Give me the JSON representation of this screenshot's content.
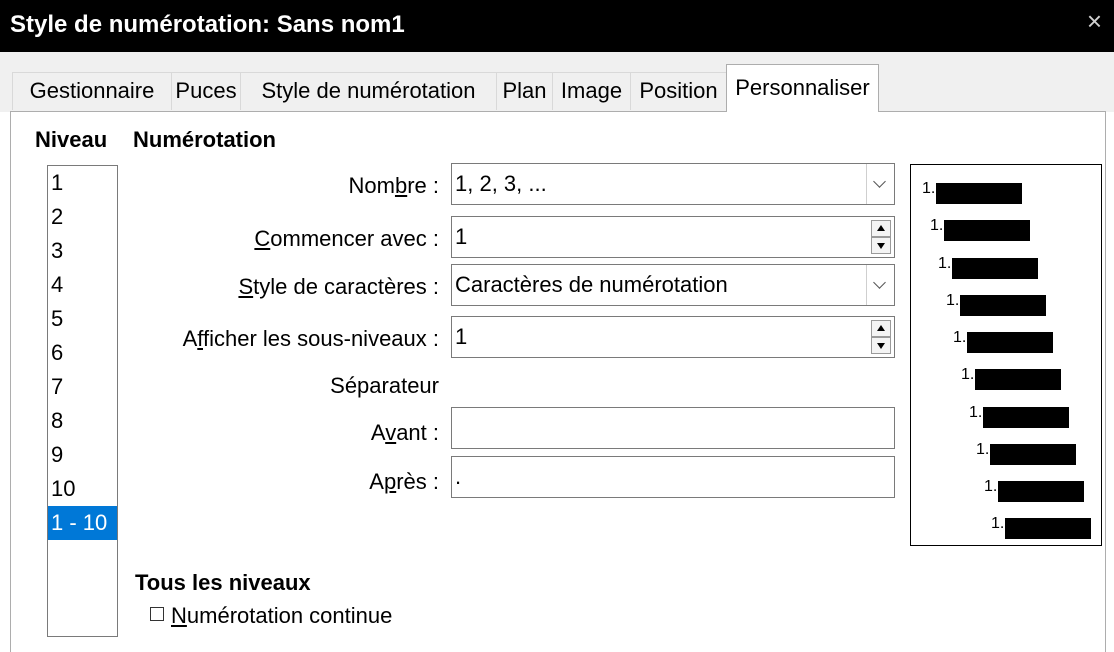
{
  "dialog": {
    "title": "Style de numérotation: Sans nom1",
    "close_glyph": "×"
  },
  "tabs": [
    {
      "label": "Gestionnaire"
    },
    {
      "label": "Puces"
    },
    {
      "label": "Style de numérotation"
    },
    {
      "label": "Plan"
    },
    {
      "label": "Image"
    },
    {
      "label": "Position"
    },
    {
      "label": "Personnaliser",
      "active": true
    }
  ],
  "level_section": {
    "heading": "Niveau",
    "items": [
      "1",
      "2",
      "3",
      "4",
      "5",
      "6",
      "7",
      "8",
      "9",
      "10",
      "1 - 10"
    ],
    "selected": "1 - 10"
  },
  "numbering": {
    "heading": "Numérotation",
    "number": {
      "label_pre": "Nom",
      "label_ul": "b",
      "label_post": "re :",
      "value": "1, 2, 3, ..."
    },
    "start_at": {
      "label_pre": "",
      "label_ul": "C",
      "label_post": "ommencer avec :",
      "value": "1"
    },
    "char_style": {
      "label_pre": "",
      "label_ul": "S",
      "label_post": "tyle de caractères :",
      "value": "Caractères de numérotation"
    },
    "sublevels": {
      "label_pre": "A",
      "label_ul": "f",
      "label_post": "ficher les sous-niveaux :",
      "value": "1"
    },
    "separator_label": "Séparateur",
    "before": {
      "label_pre": "A",
      "label_ul": "v",
      "label_post": "ant :",
      "value": ""
    },
    "after": {
      "label_pre": "A",
      "label_ul": "p",
      "label_post": "rès :",
      "value": "."
    }
  },
  "preview": {
    "rows": [
      "1.",
      "1.",
      "1.",
      "1.",
      "1.",
      "1.",
      "1.",
      "1.",
      "1.",
      "1."
    ]
  },
  "all_levels": {
    "heading": "Tous les niveaux",
    "continuous": {
      "label_ul": "N",
      "label_post": "umérotation continue",
      "checked": false
    }
  },
  "colors": {
    "selection": "#0078d7",
    "titlebar": "#000000",
    "tab_background": "#f0f0f0"
  }
}
